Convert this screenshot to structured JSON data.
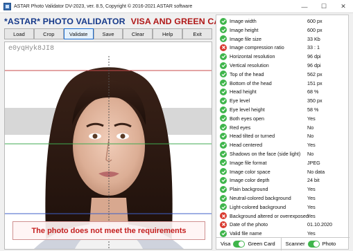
{
  "window": {
    "title": "ASTAR Photo Validator DV-2023, ver. 8.5,  Copyright © 2016-2021 ASTAR software",
    "minimize": "—",
    "maximize": "☐",
    "close": "✕"
  },
  "headline": {
    "left": "*ASTAR* PHOTO VALIDATOR",
    "right": "VISA AND GREEN CARD LOTTERY"
  },
  "toolbar": {
    "load": "Load",
    "crop": "Crop",
    "validate": "Validate",
    "save": "Save",
    "clear": "Clear",
    "help": "Help",
    "exit": "Exit"
  },
  "photo": {
    "filename": "e0yqHyk8JI8",
    "error_message": "The photo does not meet the requirements"
  },
  "colors": {
    "ok": "#3fb54b",
    "fail": "#d9392e",
    "headline_blue": "#173a8a",
    "headline_red": "#b01818",
    "error_text": "#c41f1f"
  },
  "checks": [
    {
      "label": "Image width",
      "value": "600 px",
      "status": "ok"
    },
    {
      "label": "Image height",
      "value": "600 px",
      "status": "ok"
    },
    {
      "label": "Image file size",
      "value": "33 Kb",
      "status": "ok"
    },
    {
      "label": "Image compression ratio",
      "value": "33 : 1",
      "status": "fail"
    },
    {
      "label": "Horizontal resolution",
      "value": "96 dpi",
      "status": "ok"
    },
    {
      "label": "Vertical resolution",
      "value": "96 dpi",
      "status": "ok"
    },
    {
      "label": "Top of the head",
      "value": "562 px",
      "status": "ok"
    },
    {
      "label": "Bottom of the head",
      "value": "151 px",
      "status": "ok"
    },
    {
      "label": "Head height",
      "value": "68 %",
      "status": "ok"
    },
    {
      "label": "Eye level",
      "value": "350 px",
      "status": "ok"
    },
    {
      "label": "Eye level height",
      "value": "58 %",
      "status": "ok"
    },
    {
      "label": "Both eyes open",
      "value": "Yes",
      "status": "ok"
    },
    {
      "label": "Red eyes",
      "value": "No",
      "status": "ok"
    },
    {
      "label": "Head tilted or turned",
      "value": "No",
      "status": "ok"
    },
    {
      "label": "Head centered",
      "value": "Yes",
      "status": "ok"
    },
    {
      "label": "Shadows on the face (side light)",
      "value": "No",
      "status": "ok"
    },
    {
      "label": "Image file format",
      "value": "JPEG",
      "status": "ok"
    },
    {
      "label": "Image color space",
      "value": "No data",
      "status": "ok"
    },
    {
      "label": "Image color depth",
      "value": "24 bit",
      "status": "ok"
    },
    {
      "label": "Plain background",
      "value": "Yes",
      "status": "ok"
    },
    {
      "label": "Neutral-colored background",
      "value": "Yes",
      "status": "ok"
    },
    {
      "label": "Light-colored background",
      "value": "Yes",
      "status": "ok"
    },
    {
      "label": "Background altered or overexposed",
      "value": "Yes",
      "status": "fail"
    },
    {
      "label": "Date of the photo",
      "value": "01.10.2020",
      "status": "fail"
    },
    {
      "label": "Valid file name",
      "value": "Yes",
      "status": "ok"
    }
  ],
  "bottom": {
    "visa": "Visa",
    "green_card": "Green Card",
    "scanner": "Scanner",
    "photo": "Photo",
    "visa_toggle_on": true,
    "scanner_toggle_on": true
  }
}
